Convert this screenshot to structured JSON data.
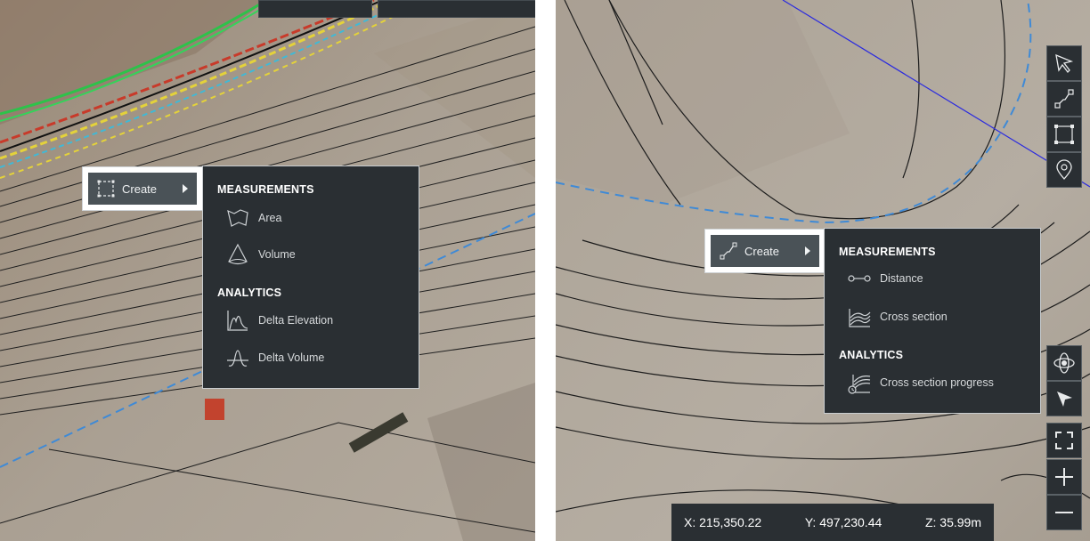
{
  "left_view": {
    "create_button": {
      "label": "Create",
      "icon": "rectangle-select-icon"
    },
    "menu": {
      "measurements_header": "MEASUREMENTS",
      "measurements": [
        {
          "label": "Area",
          "icon": "area-icon"
        },
        {
          "label": "Volume",
          "icon": "volume-icon"
        }
      ],
      "analytics_header": "ANALYTICS",
      "analytics": [
        {
          "label": "Delta Elevation",
          "icon": "delta-elevation-icon"
        },
        {
          "label": "Delta Volume",
          "icon": "delta-volume-icon"
        }
      ]
    }
  },
  "right_view": {
    "create_button": {
      "label": "Create",
      "icon": "polyline-icon"
    },
    "menu": {
      "measurements_header": "MEASUREMENTS",
      "measurements": [
        {
          "label": "Distance",
          "icon": "distance-icon"
        },
        {
          "label": "Cross section",
          "icon": "cross-section-icon"
        }
      ],
      "analytics_header": "ANALYTICS",
      "analytics": [
        {
          "label": "Cross section progress",
          "icon": "cross-section-progress-icon"
        }
      ]
    },
    "toolbar_top": [
      "select-pointer-icon",
      "polyline-tool-icon",
      "rectangle-tool-icon",
      "location-pin-icon"
    ],
    "toolbar_bottom": [
      "orbit-icon",
      "navigate-arrow-icon",
      "fullscreen-icon",
      "zoom-in-icon",
      "zoom-out-icon"
    ],
    "coordinates": {
      "x": "X: 215,350.22",
      "y": "Y: 497,230.44",
      "z": "Z: 35.99m"
    }
  },
  "colors": {
    "menu_bg": "#2a2f33",
    "button_bg": "#4a5257",
    "terrain": "#a89e91",
    "contour": "#1f1f1f",
    "dashed_blue": "#3f8ad6",
    "blue_line": "#2a2adf"
  }
}
